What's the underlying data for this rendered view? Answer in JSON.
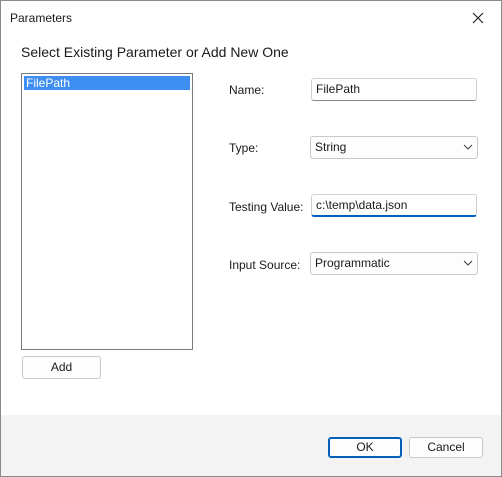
{
  "window": {
    "title": "Parameters"
  },
  "prompt": "Select Existing Parameter or Add New One",
  "parameters": {
    "items": [
      {
        "label": "FilePath",
        "selected": true
      }
    ]
  },
  "buttons": {
    "add": "Add",
    "ok": "OK",
    "cancel": "Cancel"
  },
  "form": {
    "name": {
      "label": "Name:",
      "value": "FilePath"
    },
    "type": {
      "label": "Type:",
      "value": "String"
    },
    "testing_value": {
      "label": "Testing Value:",
      "value": "c:\\temp\\data.json"
    },
    "input_source": {
      "label": "Input Source:",
      "value": "Programmatic"
    }
  },
  "icons": {
    "close": "close-icon",
    "dropdown": "chevron-down-icon"
  },
  "colors": {
    "selection": "#3d8ef0",
    "accent": "#005fb8"
  }
}
